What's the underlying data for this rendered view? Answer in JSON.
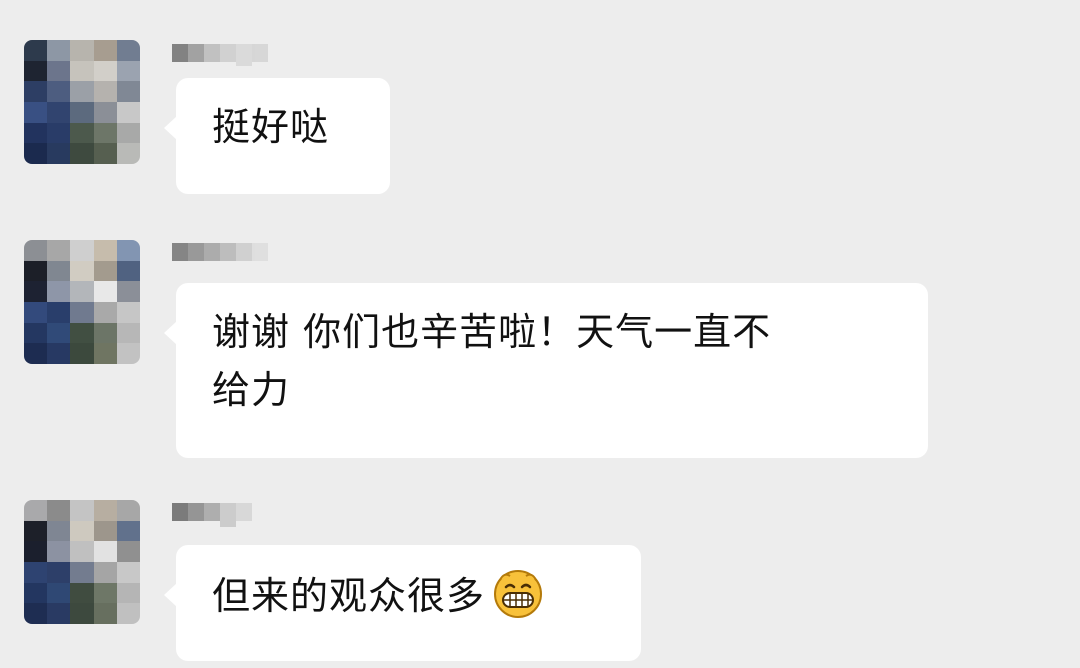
{
  "messages": [
    {
      "text": "挺好哒"
    },
    {
      "line1": "谢谢 你们也辛苦啦！天气一直不",
      "line2": "给力"
    },
    {
      "text": "但来的观众很多",
      "emoji": "grinning-face-icon"
    }
  ]
}
